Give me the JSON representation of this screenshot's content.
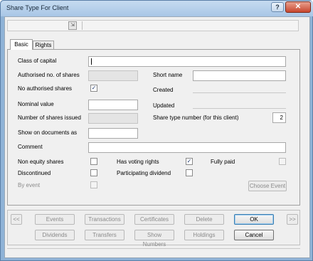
{
  "window": {
    "title": "Share Type For Client",
    "help_label": "?",
    "close_label": "✕"
  },
  "toolbar": {
    "button_glyph": "⇲"
  },
  "tabs": [
    {
      "label": "Basic",
      "selected": true
    },
    {
      "label": "Rights",
      "selected": false
    }
  ],
  "form": {
    "class_of_capital": {
      "label": "Class of capital",
      "value": ""
    },
    "authorised_no": {
      "label": "Authorised no. of shares",
      "value": ""
    },
    "short_name": {
      "label": "Short name",
      "value": ""
    },
    "no_authorised": {
      "label": "No authorised shares",
      "checked": true
    },
    "created": {
      "label": "Created",
      "value": ""
    },
    "nominal_value": {
      "label": "Nominal value",
      "value": ""
    },
    "updated": {
      "label": "Updated",
      "value": ""
    },
    "shares_issued": {
      "label": "Number of shares issued",
      "value": ""
    },
    "share_type_number": {
      "label": "Share type number (for this client)",
      "value": "2"
    },
    "show_on_documents": {
      "label": "Show on documents as",
      "value": ""
    },
    "comment": {
      "label": "Comment",
      "value": ""
    },
    "non_equity": {
      "label": "Non equity shares",
      "checked": false
    },
    "voting_rights": {
      "label": "Has voting rights",
      "checked": true
    },
    "fully_paid": {
      "label": "Fully paid",
      "checked": false
    },
    "discontinued": {
      "label": "Discontinued",
      "checked": false
    },
    "participating_dividend": {
      "label": "Participating dividend",
      "checked": false
    },
    "by_event": {
      "label": "By event",
      "checked": false
    },
    "choose_event": {
      "label": "Choose Event"
    }
  },
  "buttons": {
    "prev": "<<",
    "next": ">>",
    "events": "Events",
    "transactions": "Transactions",
    "certificates": "Certificates",
    "delete": "Delete",
    "ok": "OK",
    "dividends": "Dividends",
    "transfers": "Transfers",
    "show_numbers": "Show Numbers",
    "holdings": "Holdings",
    "cancel": "Cancel"
  },
  "check_glyph": "✓"
}
